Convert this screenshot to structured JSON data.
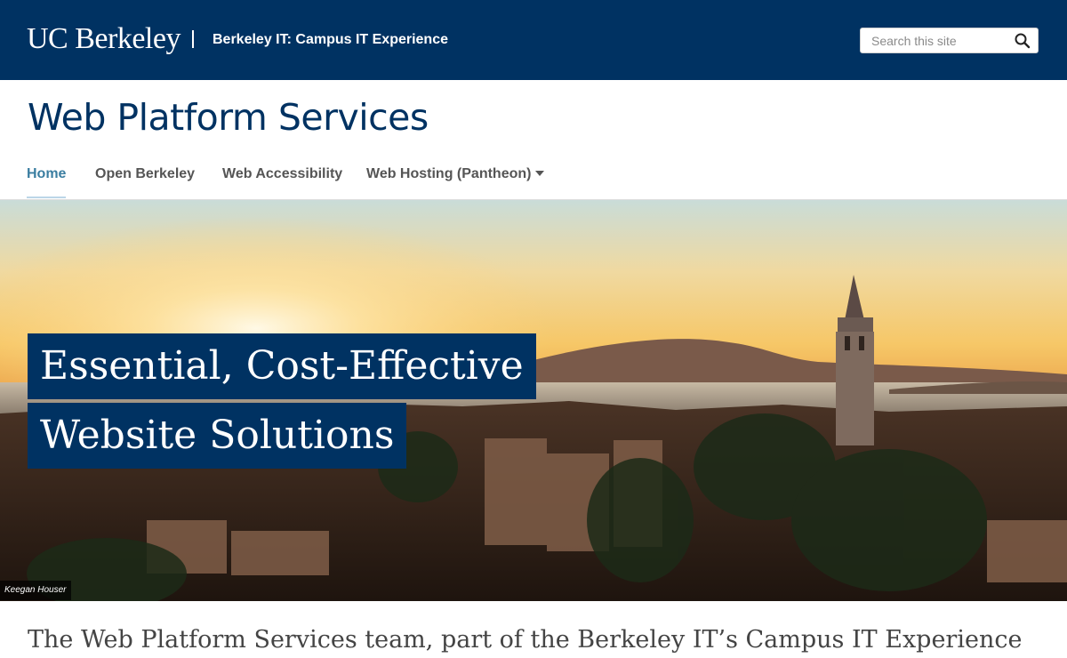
{
  "header": {
    "logo": "UC Berkeley",
    "unit_name": "Berkeley IT: Campus IT Experience",
    "search": {
      "placeholder": "Search this site",
      "value": ""
    }
  },
  "site": {
    "title": "Web Platform Services"
  },
  "nav": {
    "items": [
      {
        "label": "Home",
        "active": true
      },
      {
        "label": "Open Berkeley"
      },
      {
        "label": "Web Accessibility"
      },
      {
        "label": "Web Hosting (Pantheon)",
        "has_dropdown": true
      }
    ]
  },
  "hero": {
    "line1": "Essential, Cost-Effective",
    "line2": "Website Solutions",
    "photo_credit": "Keegan Houser"
  },
  "intro": {
    "text": "The Web Platform Services team, part of the Berkeley IT’s Campus IT Experience"
  },
  "colors": {
    "brand_blue": "#003262",
    "nav_active": "#3b7ea1",
    "founders_rock": "#3b7ea1"
  }
}
